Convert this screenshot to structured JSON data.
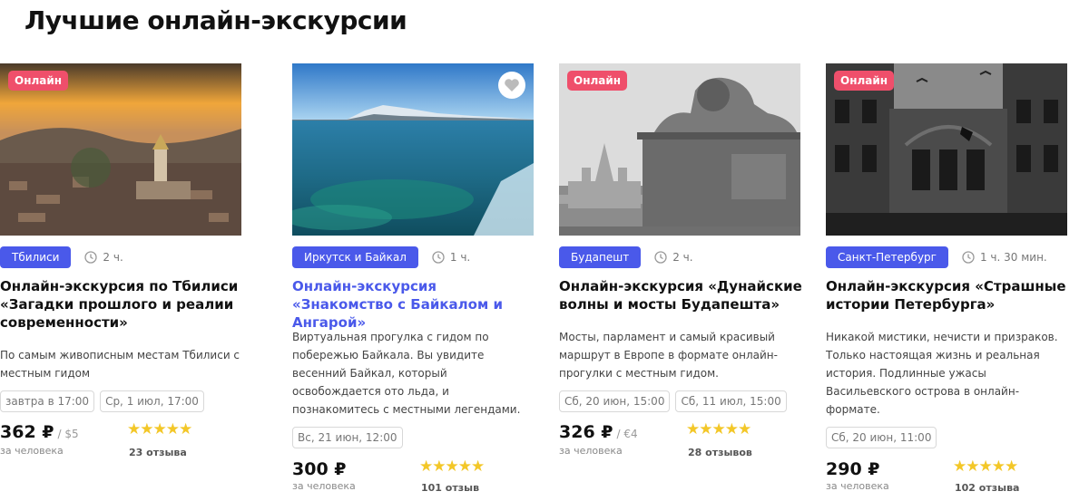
{
  "page_title": "Лучшие онлайн-экскурсии",
  "colors": {
    "accent": "#4a59ea",
    "badge": "#ef4f6b",
    "star": "#f3c728"
  },
  "cards": [
    {
      "badge": "",
      "city": "Иркутск и Байкал",
      "duration": "1 ч.",
      "title": "Онлайн-экскурсия «Знакомство с Байкалом и Ангарой»",
      "description": "Виртуальная прогулка с гидом по побережью Байкала. Вы увидите весенний Байкал, который освобождается ото льда, и познакомитесь с местными легендами.",
      "dates": [
        "Вс, 21 июн, 12:00"
      ],
      "price": "300 ₽",
      "price_alt": "",
      "per_person": "за человека",
      "rating_stars": "★★★★★",
      "rating": 5,
      "reviews": "101 отзыв"
    },
    {
      "badge": "Онлайн",
      "city": "Будапешт",
      "duration": "2 ч.",
      "title": "Онлайн-экскурсия «Дунайские волны и мосты Будапешта»",
      "description": "Мосты, парламент и самый красивый маршрут в Европе в формате онлайн-прогулки с местным гидом.",
      "dates": [
        "Сб, 20 июн, 15:00",
        "Сб, 11 июл, 15:00"
      ],
      "price": "326 ₽",
      "price_alt": "/ €4",
      "per_person": "за человека",
      "rating_stars": "★★★★★",
      "rating": 5,
      "reviews": "28 отзывов"
    },
    {
      "badge": "Онлайн",
      "city": "Санкт-Петербург",
      "duration": "1 ч. 30 мин.",
      "title": "Онлайн-экскурсия «Страшные истории Петербурга»",
      "description": "Никакой мистики, нечисти и призраков. Только настоящая жизнь и реальная история. Подлинные ужасы Васильевского острова в онлайн-формате.",
      "dates": [
        "Сб, 20 июн, 11:00"
      ],
      "price": "290 ₽",
      "price_alt": "",
      "per_person": "за человека",
      "rating_stars": "★★★★★",
      "rating": 5,
      "reviews": "102 отзыва"
    },
    {
      "badge": "Онлайн",
      "city": "Тбилиси",
      "duration": "2 ч.",
      "title": "Онлайн-экскурсия по Тбилиси «Загадки прошлого и реалии современности»",
      "description": "По самым живописным местам Тбилиси с местным гидом",
      "dates": [
        "завтра в 17:00",
        "Ср, 1 июл, 17:00"
      ],
      "price": "362 ₽",
      "price_alt": "/ $5",
      "per_person": "за человека",
      "rating_stars": "★★★★★",
      "rating": 5,
      "reviews": "23 отзыва"
    }
  ]
}
